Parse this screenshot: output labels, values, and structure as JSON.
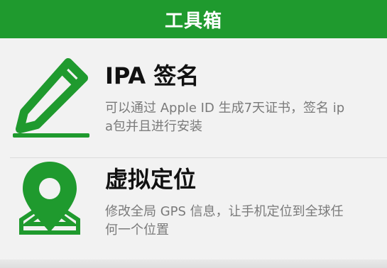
{
  "header": {
    "title": "工具箱"
  },
  "items": [
    {
      "title": "IPA 签名",
      "description": "可以通过 Apple ID 生成7天证书，签名 ip\na包并且进行安装",
      "icon": "pencil-icon"
    },
    {
      "title": "虚拟定位",
      "description": "修改全局 GPS 信息，让手机定位到全球任\n何一个位置",
      "icon": "location-pin-icon"
    }
  ],
  "colors": {
    "brand_green": "#1f9a2e",
    "title_text": "#111111",
    "desc_text": "#7a7a7a",
    "background": "#f2f2f2"
  }
}
